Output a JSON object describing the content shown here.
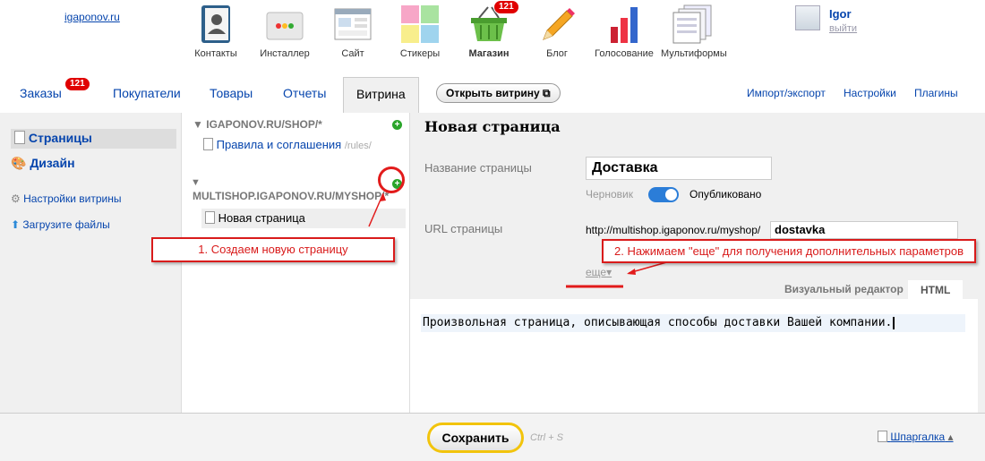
{
  "site": {
    "link": "igaponov.ru"
  },
  "apps": [
    {
      "label": "Контакты",
      "icon": "contacts-icon"
    },
    {
      "label": "Инсталлер",
      "icon": "installer-icon"
    },
    {
      "label": "Сайт",
      "icon": "site-icon"
    },
    {
      "label": "Стикеры",
      "icon": "stickers-icon"
    },
    {
      "label": "Магазин",
      "icon": "shop-basket-icon",
      "badge": "121"
    },
    {
      "label": "Блог",
      "icon": "pencil-icon"
    },
    {
      "label": "Голосование",
      "icon": "poll-chart-icon"
    },
    {
      "label": "Мультиформы",
      "icon": "multiforms-icon"
    }
  ],
  "user": {
    "name": "Igor",
    "logout": "выйти"
  },
  "tabs": {
    "orders": "Заказы",
    "orders_badge": "121",
    "customers": "Покупатели",
    "products": "Товары",
    "reports": "Отчеты",
    "storefront": "Витрина"
  },
  "open_storefront": "Открыть витрину",
  "right_links": {
    "import_export": "Импорт/экспорт",
    "settings": "Настройки",
    "plugins": "Плагины"
  },
  "sidebar": {
    "pages": "Страницы",
    "design": "Дизайн",
    "storefront_settings": "Настройки витрины",
    "upload_files": "Загрузите файлы"
  },
  "tree": {
    "host1": "IGAPONOV.RU/SHOP/*",
    "host1_page": "Правила и соглашения",
    "host1_page_url": "/rules/",
    "host2": "MULTISHOP.IGAPONOV.RU/MYSHOP/*",
    "host2_page": "Новая страница"
  },
  "editor": {
    "title": "Новая страница",
    "name_label": "Название страницы",
    "name_value": "Доставка",
    "draft": "Черновик",
    "published": "Опубликовано",
    "url_label": "URL страницы",
    "url_prefix": "http://multishop.igaponov.ru/myshop/",
    "url_value": "dostavka",
    "more": "еще",
    "tab_visual": "Визуальный редактор",
    "tab_html": "HTML",
    "content": "Произвольная страница, описывающая способы доставки Вашей компании."
  },
  "callouts": {
    "one": "1. Создаем новую страницу",
    "two": "2. Нажимаем \"еще\" для получения дополнительных параметров"
  },
  "footer": {
    "save": "Сохранить",
    "shortcut": "Ctrl + S",
    "cheatsheet": "Шпаргалка"
  }
}
